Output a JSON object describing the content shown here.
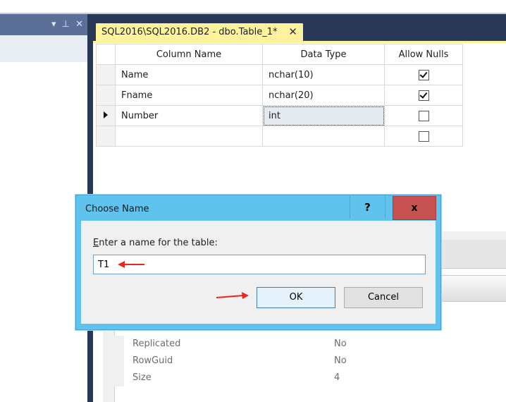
{
  "tab": {
    "title": "SQL2016\\SQL2016.DB2 - dbo.Table_1*",
    "close": "✕"
  },
  "left_panel": {
    "pin": "▾ ⊥ ✕"
  },
  "grid": {
    "headers": [
      "Column Name",
      "Data Type",
      "Allow Nulls"
    ],
    "rows": [
      {
        "name": "Name",
        "type": "nchar(10)",
        "allow_nulls": true
      },
      {
        "name": "Fname",
        "type": "nchar(20)",
        "allow_nulls": true
      },
      {
        "name": "Number",
        "type": "int",
        "allow_nulls": false
      },
      {
        "name": "",
        "type": "",
        "allow_nulls": false
      }
    ]
  },
  "properties": [
    {
      "name": "Replicated",
      "value": "No"
    },
    {
      "name": "RowGuid",
      "value": "No"
    },
    {
      "name": "Size",
      "value": "4"
    }
  ],
  "dialog": {
    "title": "Choose Name",
    "help": "?",
    "close": "x",
    "prompt_prefix": "E",
    "prompt_rest": "nter a name for the table:",
    "input_value": "T1",
    "ok": "OK",
    "cancel": "Cancel"
  },
  "colors": {
    "arrow": "#e8281e",
    "dialog_frame": "#5fc3ee",
    "close_button": "#c75050",
    "tab": "#fff29d",
    "dark_frame": "#293955"
  }
}
